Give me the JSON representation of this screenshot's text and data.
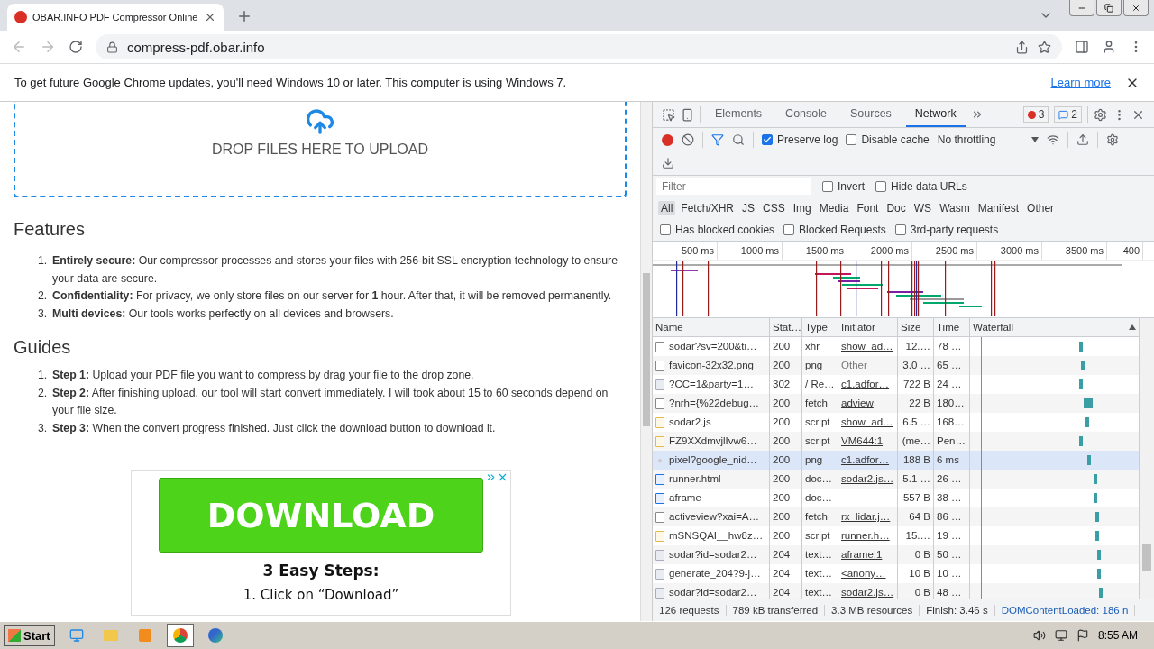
{
  "browser": {
    "tab_title": "OBAR.INFO PDF Compressor Online",
    "url": "compress-pdf.obar.info",
    "infobar": {
      "message": "To get future Google Chrome updates, you'll need Windows 10 or later. This computer is using Windows 7.",
      "link": "Learn more"
    }
  },
  "page": {
    "drop_zone_label": "DROP FILES HERE TO UPLOAD",
    "sections": [
      {
        "heading": "Features",
        "items": [
          {
            "marker": "1.",
            "text": "**Entirely secure:** Our compressor processes and stores your files with 256-bit SSL encryption technology to ensure your data are secure."
          },
          {
            "marker": "2.",
            "text": "**Confidentiality:** For privacy, we only store files on our server for **1** hour. After that, it will be removed permanently."
          },
          {
            "marker": "3.",
            "text": "**Multi devices:** Our tools works perfectly on all devices and browsers."
          }
        ]
      },
      {
        "heading": "Guides",
        "items": [
          {
            "marker": "1.",
            "text": "**Step 1:** Upload your PDF file you want to compress by drag your file to the drop zone."
          },
          {
            "marker": "2.",
            "text": "**Step 2:** After finishing upload, our tool will start convert immediately. I will took about 15 to 60 seconds depend on your file size."
          },
          {
            "marker": "3.",
            "text": "**Step 3:** When the convert progress finished. Just click the download button to download it."
          }
        ]
      }
    ],
    "ad": {
      "button": "DOWNLOAD",
      "heading": "3 Easy Steps:",
      "step": "1. Click on “Download”"
    }
  },
  "devtools": {
    "tabs": [
      {
        "label": "Elements",
        "selected": false
      },
      {
        "label": "Console",
        "selected": false
      },
      {
        "label": "Sources",
        "selected": false
      },
      {
        "label": "Network",
        "selected": true
      }
    ],
    "error_count": "3",
    "message_count": "2",
    "toggles": [
      {
        "label": "Preserve log",
        "checked": true
      },
      {
        "label": "Disable cache",
        "checked": false
      }
    ],
    "throttling": "No throttling",
    "filter": {
      "placeholder": "Filter"
    },
    "filter_toggles": [
      {
        "label": "Invert",
        "checked": false
      },
      {
        "label": "Hide data URLs",
        "checked": false
      }
    ],
    "types": [
      {
        "label": "All",
        "selected": true
      },
      {
        "label": "Fetch/XHR",
        "selected": false
      },
      {
        "label": "JS",
        "selected": false
      },
      {
        "label": "CSS",
        "selected": false
      },
      {
        "label": "Img",
        "selected": false
      },
      {
        "label": "Media",
        "selected": false
      },
      {
        "label": "Font",
        "selected": false
      },
      {
        "label": "Doc",
        "selected": false
      },
      {
        "label": "WS",
        "selected": false
      },
      {
        "label": "Wasm",
        "selected": false
      },
      {
        "label": "Manifest",
        "selected": false
      },
      {
        "label": "Other",
        "selected": false
      }
    ],
    "request_toggles": [
      {
        "label": "Has blocked cookies",
        "checked": false
      },
      {
        "label": "Blocked Requests",
        "checked": false
      },
      {
        "label": "3rd-party requests",
        "checked": false
      }
    ],
    "overview_ticks": [
      "500 ms",
      "1000 ms",
      "1500 ms",
      "2000 ms",
      "2500 ms",
      "3000 ms",
      "3500 ms",
      "400"
    ],
    "columns": [
      "Name",
      "Stat…",
      "Type",
      "Initiator",
      "Size",
      "Time",
      "Waterfall"
    ],
    "rows": [
      {
        "kind": "blank",
        "name": "sodar?sv=200&ti…",
        "status": "200",
        "type": "xhr",
        "initiator": "show_ad…",
        "link": true,
        "size": "12.…",
        "time": "78 …",
        "highlighted": false
      },
      {
        "kind": "blank",
        "name": "favicon-32x32.png",
        "status": "200",
        "type": "png",
        "initiator": "Other",
        "link": false,
        "size": "3.0 …",
        "time": "65 …",
        "highlighted": false
      },
      {
        "kind": "image",
        "name": "?CC=1&party=1…",
        "status": "302",
        "type": "/ Re…",
        "initiator": "c1.adfor…",
        "link": true,
        "size": "722 B",
        "time": "24 …",
        "highlighted": false
      },
      {
        "kind": "blank",
        "name": "?nrh={%22debug…",
        "status": "200",
        "type": "fetch",
        "initiator": "adview",
        "link": true,
        "size": "22 B",
        "time": "180…",
        "highlighted": false
      },
      {
        "kind": "script",
        "name": "sodar2.js",
        "status": "200",
        "type": "script",
        "initiator": "show_ad…",
        "link": true,
        "size": "6.5 …",
        "time": "168…",
        "highlighted": false
      },
      {
        "kind": "script",
        "name": "FZ9XXdmvjlIvw6…",
        "status": "200",
        "type": "script",
        "initiator": "VM644:1",
        "link": true,
        "size": "(me…",
        "time": "Pen…",
        "highlighted": false
      },
      {
        "kind": "dot",
        "name": "pixel?google_nid…",
        "status": "200",
        "type": "png",
        "initiator": "c1.adfor…",
        "link": true,
        "size": "188 B",
        "time": "6 ms",
        "highlighted": true
      },
      {
        "kind": "doc",
        "name": "runner.html",
        "status": "200",
        "type": "doc…",
        "initiator": "sodar2.js…",
        "link": true,
        "size": "5.1 …",
        "time": "26 …",
        "highlighted": false
      },
      {
        "kind": "doc",
        "name": "aframe",
        "status": "200",
        "type": "doc…",
        "size": "557 B",
        "time": "38 …",
        "highlighted": false
      },
      {
        "kind": "blank",
        "name": "activeview?xai=A…",
        "status": "200",
        "type": "fetch",
        "initiator": "rx_lidar.j…",
        "link": true,
        "size": "64 B",
        "time": "86 …",
        "highlighted": false
      },
      {
        "kind": "script",
        "name": "mSNSQAI__hw8z…",
        "status": "200",
        "type": "script",
        "initiator": "runner.h…",
        "link": true,
        "size": "15.…",
        "time": "19 …",
        "highlighted": false
      },
      {
        "kind": "image",
        "name": "sodar?id=sodar2…",
        "status": "204",
        "type": "text…",
        "initiator": "aframe:1",
        "link": true,
        "size": "0 B",
        "time": "50 …",
        "highlighted": false
      },
      {
        "kind": "image",
        "name": "generate_204?9-j…",
        "status": "204",
        "type": "text…",
        "initiator": "<anony…",
        "link": true,
        "size": "10 B",
        "time": "10 …",
        "highlighted": false
      },
      {
        "kind": "image",
        "name": "sodar?id=sodar2…",
        "status": "204",
        "type": "text…",
        "initiator": "sodar2.js…",
        "link": true,
        "size": "0 B",
        "time": "48 …",
        "highlighted": false
      }
    ],
    "status_bar": [
      "126 requests",
      "789 kB transferred",
      "3.3 MB resources",
      "Finish: 3.46 s",
      "DOMContentLoaded: 186 n"
    ]
  },
  "taskbar": {
    "start": "Start",
    "clock": "8:55 AM"
  }
}
